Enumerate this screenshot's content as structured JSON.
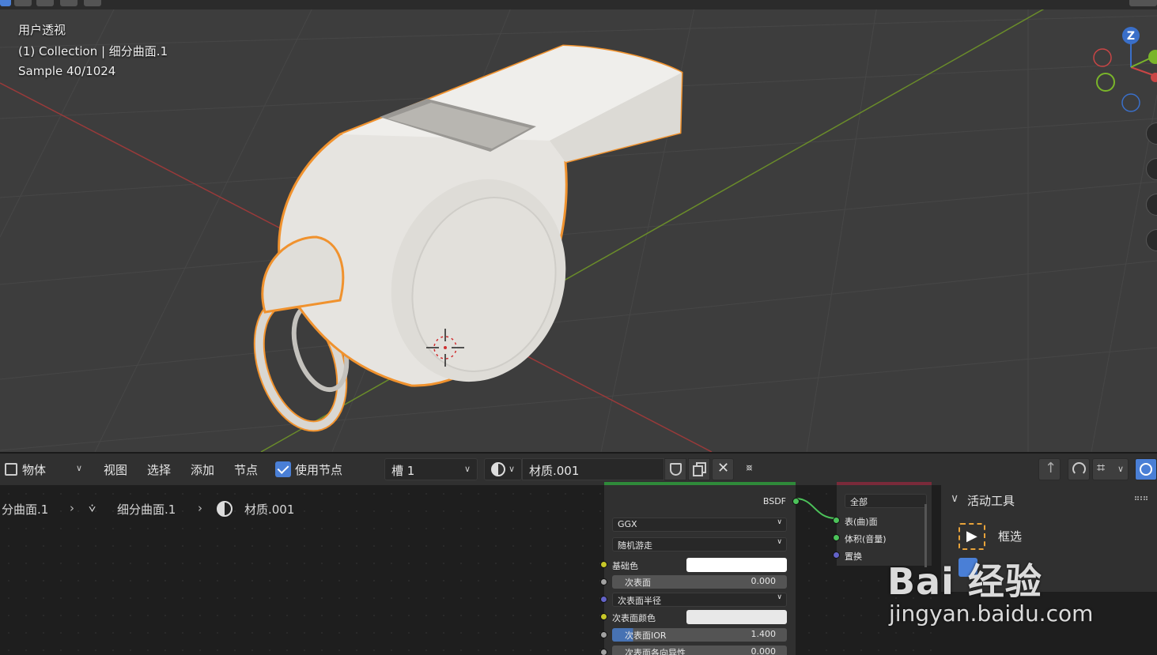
{
  "viewport": {
    "overlay": {
      "view_name": "用户透视",
      "collection_line": "(1) Collection | 细分曲面.1",
      "sample_line": "Sample 40/1024"
    },
    "gizmo_axis_label": "Z",
    "colors": {
      "background": "#3d3d3d",
      "grid": "#474747",
      "x_axis": "#9a3a3a",
      "y_axis": "#6a8c2a",
      "selection_outline": "#f0922e",
      "object": "#e6e4e0"
    }
  },
  "node_header": {
    "mode_select": "物体",
    "menus": [
      "视图",
      "选择",
      "添加",
      "节点"
    ],
    "use_nodes_label": "使用节点",
    "use_nodes_checked": true,
    "slot_select": "槽 1",
    "material_name": "材质.001"
  },
  "breadcrumb": {
    "object": "分曲面.1",
    "mesh": "细分曲面.1",
    "material": "材质.001"
  },
  "bsdf_node": {
    "output_label": "BSDF",
    "distribution": "GGX",
    "subsurface_method": "随机游走",
    "inputs": {
      "base_color": "基础色",
      "subsurface": "次表面",
      "subsurface_value": "0.000",
      "subsurface_radius": "次表面半径",
      "subsurface_color": "次表面颜色",
      "subsurface_ior": "次表面IOR",
      "subsurface_ior_value": "1.400",
      "subsurface_anisotropy": "次表面各向异性",
      "subsurface_anisotropy_value": "0.000"
    },
    "colors": {
      "header": "#2f8a3a",
      "base_color_swatch": "#ffffff",
      "subsurface_color_swatch": "#e8e8e8"
    }
  },
  "output_node": {
    "target": "全部",
    "inputs": [
      "表(曲)面",
      "体积(音量)",
      "置换"
    ]
  },
  "sidebar": {
    "panel_title": "活动工具",
    "tool_name": "框选"
  },
  "watermark": {
    "logo_text": "Bai 经验",
    "url": "jingyan.baidu.com"
  }
}
